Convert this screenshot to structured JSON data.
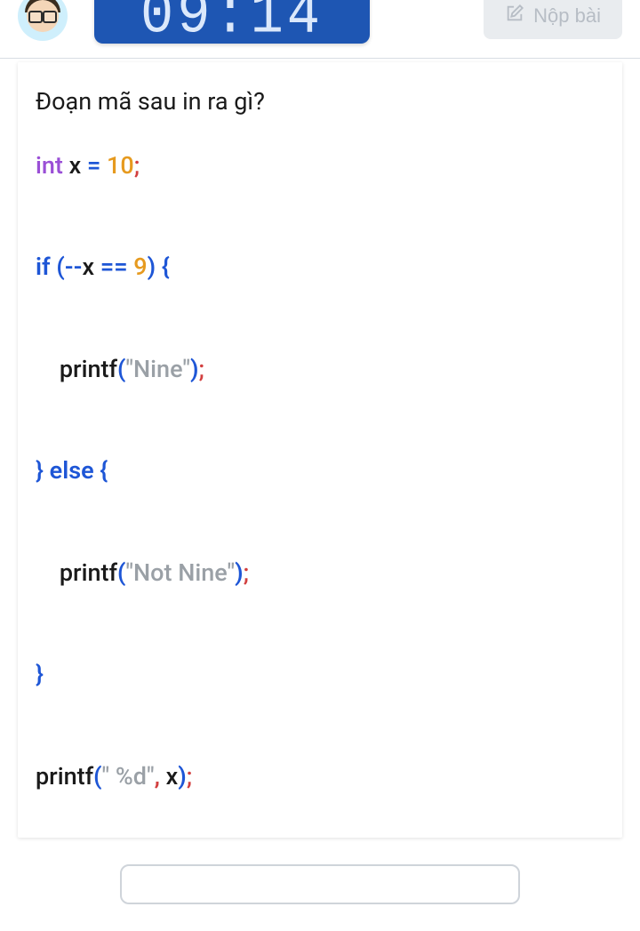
{
  "header": {
    "timer_display": "09:14",
    "submit_label": "Nộp bài"
  },
  "question": {
    "prompt": "Đoạn mã sau in ra gì?"
  },
  "code": {
    "l1": {
      "t_int": "int",
      "sp1": " ",
      "x": "x",
      "sp2": " ",
      "eq": "=",
      "sp3": " ",
      "n10": "10",
      "semi": ";"
    },
    "l2": {
      "t_if": "if",
      "sp1": " ",
      "lp": "(",
      "mm": "--",
      "x": "x",
      "sp2": " ",
      "eqeq": "==",
      "sp3": " ",
      "n9": "9",
      "rp": ")",
      "sp4": " ",
      "lb": "{"
    },
    "l3": {
      "indent": "    ",
      "fn": "printf",
      "lp": "(",
      "q1": "\"",
      "s": "Nine",
      "q2": "\"",
      "rp": ")",
      "semi": ";"
    },
    "l4": {
      "rb": "}",
      "sp1": " ",
      "t_else": "else",
      "sp2": " ",
      "lb": "{"
    },
    "l5": {
      "indent": "    ",
      "fn": "printf",
      "lp": "(",
      "q1": "\"",
      "s": "Not Nine",
      "q2": "\"",
      "rp": ")",
      "semi": ";"
    },
    "l6": {
      "rb": "}"
    },
    "l7": {
      "fn": "printf",
      "lp": "(",
      "q1": "\"",
      "s": " %d",
      "q2": "\"",
      "comma": ",",
      "sp": " ",
      "x": "x",
      "rp": ")",
      "semi": ";"
    }
  },
  "answer": {
    "value": "",
    "placeholder": ""
  }
}
